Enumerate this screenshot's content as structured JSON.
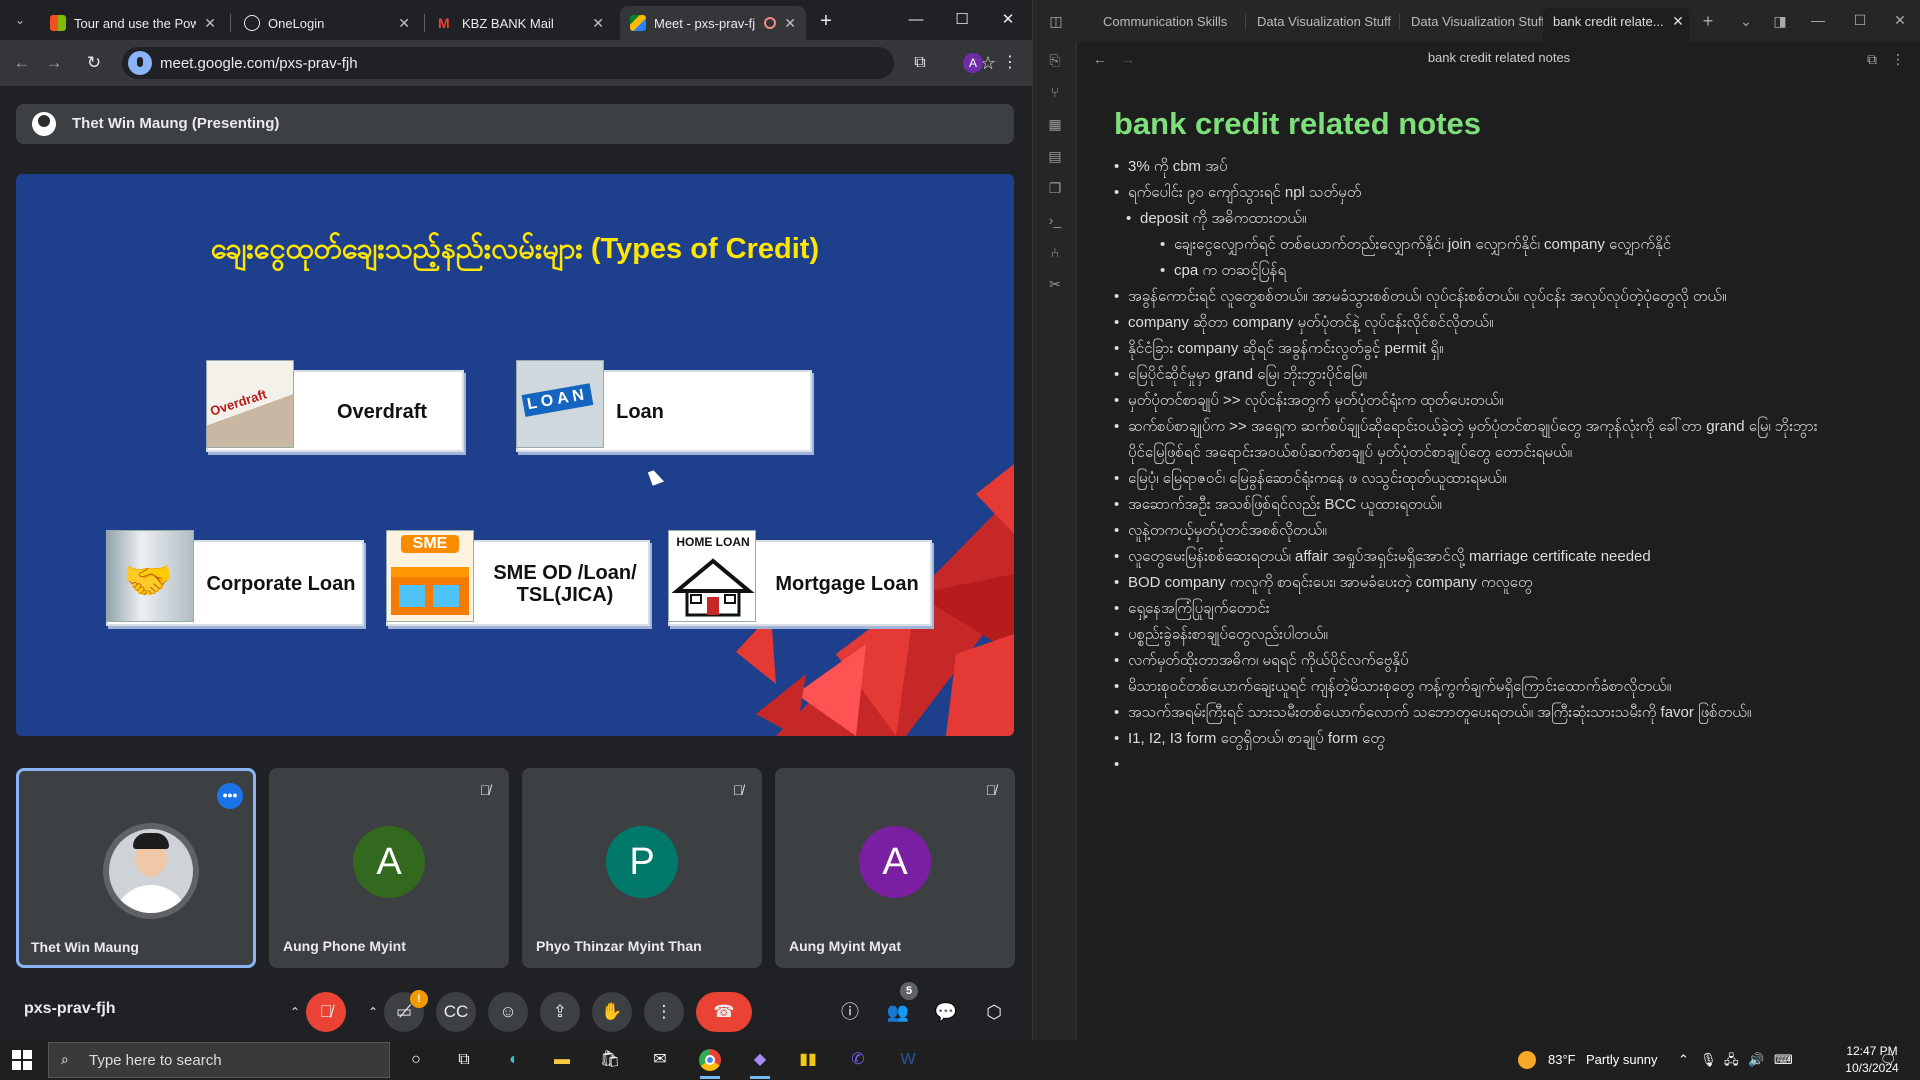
{
  "browser": {
    "tabs": [
      {
        "title": "Tour and use the Power",
        "active": false
      },
      {
        "title": "OneLogin",
        "active": false
      },
      {
        "title": "KBZ BANK Mail",
        "active": false
      },
      {
        "title": "Meet - pxs-prav-fjh",
        "active": true
      }
    ],
    "url": "meet.google.com/pxs-prav-fjh",
    "profile_initial": "A"
  },
  "meet": {
    "presenter_label": "Thet Win Maung (Presenting)",
    "slide": {
      "title": "ချေးငွေထုတ်ချေးသည့်နည်းလမ်းများ (Types of Credit)",
      "cards": [
        {
          "label": "Overdraft",
          "image_text": "Overdraft"
        },
        {
          "label": "Loan",
          "image_text": "LOAN"
        },
        {
          "label": "Corporate Loan",
          "image_text": ""
        },
        {
          "label": "SME OD /Loan/ TSL(JICA)",
          "image_text": "SME"
        },
        {
          "label": "Mortgage Loan",
          "image_text": "HOME LOAN"
        }
      ]
    },
    "participants": [
      {
        "name": "Thet Win Maung",
        "initial": "",
        "color": "",
        "muted": false
      },
      {
        "name": "Aung Phone Myint",
        "initial": "A",
        "color": "#33691e",
        "muted": true
      },
      {
        "name": "Phyo Thinzar Myint Than",
        "initial": "P",
        "color": "#00796b",
        "muted": true
      },
      {
        "name": "Aung Myint Myat",
        "initial": "A",
        "color": "#7b1fa2",
        "muted": true
      }
    ],
    "meeting_code": "pxs-prav-fjh",
    "people_count": "5",
    "camera_alert": "!"
  },
  "obsidian": {
    "tabs": [
      "Communication Skills",
      "Data Visualization Stuff",
      "Data Visualization Stuff",
      "bank credit relate..."
    ],
    "header_title": "bank credit related notes",
    "note_title": "bank credit related notes",
    "bullets": [
      {
        "text": "3% ကို cbm အပ်",
        "level": 0
      },
      {
        "text": "ရက်ပေါင်း ၉၀ ကျော်သွားရင် npl သတ်မှတ်",
        "level": 0
      },
      {
        "text": "deposit ကို အဓိကထားတယ်။",
        "level": 1
      },
      {
        "text": "ချေးငွေလျှောက်ရင် တစ်ယောက်တည်းလျှောက်နိုင်၊ join လျှောက်နိုင်၊ company လျှောက်နိုင်",
        "level": 2
      },
      {
        "text": "cpa က တဆင့်ပြန်ရ",
        "level": 2
      },
      {
        "text": "အခွန်ကောင်းရင် လူတွေစစ်တယ်။ အာမခံသွားစစ်တယ်၊ လုပ်ငန်းစစ်တယ်။ လုပ်ငန်း အလုပ်လုပ်တဲ့ပုံတွေလို တယ်။",
        "level": 0
      },
      {
        "text": "company ဆိုတာ company မှတ်ပုံတင်နဲ့ လုပ်ငန်းလိုင်စင်လိုတယ်။",
        "level": 0
      },
      {
        "text": "နိုင်ငံခြား company ဆိုရင် အခွန်ကင်းလွတ်ခွင့် permit ရှိ။",
        "level": 0
      },
      {
        "text": "မြေပိုင်ဆိုင်မှုမှာ grand မြေ၊ ဘိုးဘွားပိုင်မြေ။",
        "level": 0
      },
      {
        "text": "မှတ်ပုံတင်စာချုပ် >> လုပ်ငန်းအတွက် မှတ်ပုံတင်ရုံးက ထုတ်ပေးတယ်။",
        "level": 0
      },
      {
        "text": "ဆက်စပ်စာချုပ်က >> အရှေ့က ဆက်စပ်ချုပ်ဆိုရောင်းဝယ်ခဲ့တဲ့ မှတ်ပုံတင်စာချုပ်တွေ အကုန်လုံးကို ခေါ်တာ grand မြေ၊ ဘိုးဘွားပိုင်မြေဖြစ်ရင် အရောင်းအဝယ်စပ်ဆက်စာချုပ် မှတ်ပုံတင်စာချုပ်တွေ တောင်းရမယ်။",
        "level": 0
      },
      {
        "text": "မြေပုံ၊ မြေရာဇဝင်၊ မြေခွန်ဆောင်ရုံးကနေ ဖ လသွင်းထုတ်ယူထားရမယ်။",
        "level": 0
      },
      {
        "text": "အဆောက်အဦး အသစ်ဖြစ်ရင်လည်း BCC ယူထားရတယ်။",
        "level": 0
      },
      {
        "text": "လူနဲ့တကယ့်မှတ်ပုံတင်အစစ်လိုတယ်။",
        "level": 0
      },
      {
        "text": "လူတွေမေးမြန်းစစ်ဆေးရတယ်၊ affair အရှုပ်အရှင်းမရှိအောင်လို့ marriage certificate needed",
        "level": 0
      },
      {
        "text": "BOD company ကလူကို စာရင်းပေး၊ အာမခံပေးတဲ့ company ကလူတွေ",
        "level": 0
      },
      {
        "text": "ရှေ့နေအကြံပြုချက်တောင်း",
        "level": 0
      },
      {
        "text": "ပစ္စည်းခွဲခန်းစာချုပ်တွေလည်းပါတယ်။",
        "level": 0
      },
      {
        "text": "လက်မှတ်ထိုးတာအဓိက၊ မရရင် ကိုယ်ပိုင်လက်ဗွေနှိပ်",
        "level": 0
      },
      {
        "text": "မိသားစုဝင်တစ်ယောက်ချေးယူရင် ကျန်တဲ့မိသားစုတွေ ကန့်ကွက်ချက်မရှိကြောင်းထောက်ခံစာလိုတယ်။",
        "level": 0
      },
      {
        "text": "အသက်အရမ်းကြီးရင် သားသမီးတစ်ယောက်လောက် သဘောတူပေးရတယ်။ အကြီးဆုံးသားသမီးကို favor ဖြစ်တယ်။",
        "level": 0
      },
      {
        "text": "I1, I2, I3 form တွေရှိတယ်၊ စာချုပ် form တွေ",
        "level": 0
      },
      {
        "text": "",
        "level": 0
      }
    ]
  },
  "taskbar": {
    "search_placeholder": "Type here to search",
    "weather_temp": "83°F",
    "weather_desc": "Partly sunny",
    "time": "12:47 PM",
    "date": "10/3/2024"
  }
}
